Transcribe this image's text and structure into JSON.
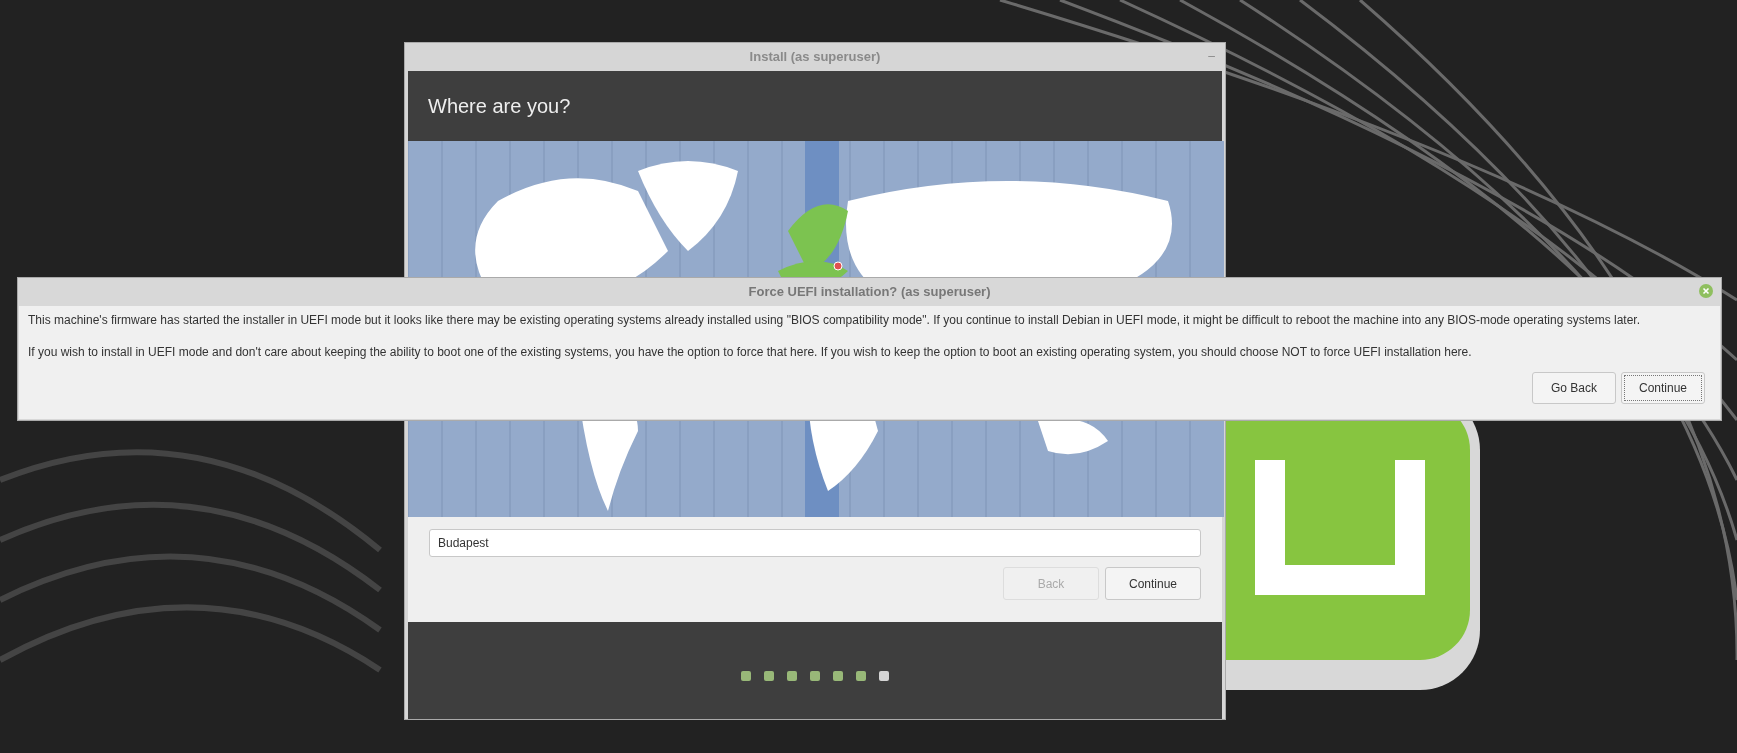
{
  "installer": {
    "title": "Install (as superuser)",
    "minimize": "–",
    "heading": "Where are you?",
    "location": {
      "value": "Budapest"
    },
    "buttons": [
      {
        "label": "Back",
        "disabled": true
      },
      {
        "label": "Continue",
        "disabled": false
      }
    ],
    "steps": [
      {
        "done": true
      },
      {
        "done": true
      },
      {
        "done": true
      },
      {
        "done": true
      },
      {
        "done": true
      },
      {
        "done": true
      },
      {
        "done": false
      }
    ]
  },
  "dialog": {
    "title": "Force UEFI installation? (as superuser)",
    "paragraphs": [
      "This machine's firmware has started the installer in UEFI mode but it looks like there may be existing operating systems already installed using \"BIOS compatibility mode\". If you continue to install Debian in UEFI mode, it might be difficult to reboot the machine into any BIOS-mode operating systems later.",
      "If you wish to install in UEFI mode and don't care about keeping the ability to boot one of the existing systems, you have the option to force that here. If you wish to keep the option to boot an existing operating system, you should choose NOT to force UEFI installation here."
    ],
    "buttons": [
      {
        "label": "Go Back",
        "focused": false
      },
      {
        "label": "Continue",
        "focused": true
      }
    ]
  }
}
